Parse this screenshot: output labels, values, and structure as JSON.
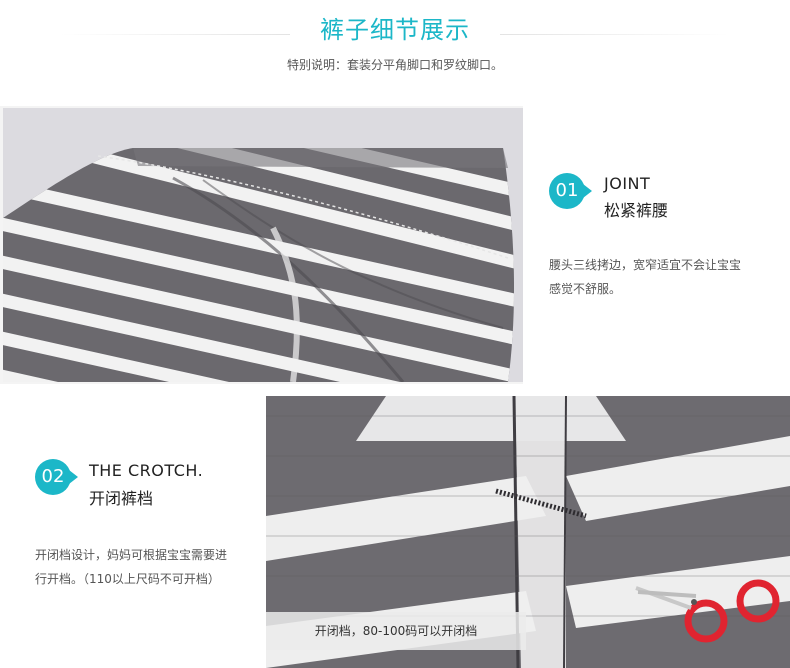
{
  "header": {
    "title": "裤子细节展示",
    "note": "特别说明：套装分平角脚口和罗纹脚口。"
  },
  "section1": {
    "badge": "01",
    "title_en": "JOINT",
    "title_cn": "松紧裤腰",
    "desc_line1": "腰头三线拷边，宽窄适宜不会让宝宝",
    "desc_line2": "感觉不舒服。"
  },
  "section2": {
    "badge": "02",
    "title_en": "THE CROTCH.",
    "title_cn": "开闭裤档",
    "desc_line1": "开闭档设计，妈妈可根据宝宝需要进",
    "desc_line2": "行开档。（110以上尺码不可开档）",
    "caption": "开闭档，80-100码可以开闭档"
  },
  "colors": {
    "accent": "#1cb7c8",
    "stripe_gray": "#6b696e",
    "stripe_white": "#f2f2f2",
    "scissors_red": "#e02430"
  },
  "icons": [
    "scissors-icon"
  ]
}
